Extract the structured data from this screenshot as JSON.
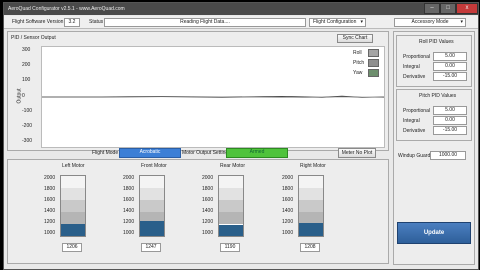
{
  "window": {
    "title": "AeroQuad Configurator v2.5.1 - www.AeroQuad.com",
    "buttons": [
      "–",
      "□",
      "x"
    ]
  },
  "toolbar": {
    "fw_label": "Flight Software Version",
    "fw_value": "3.2",
    "status_label": "Status",
    "status_value": "Reading Flight Data....",
    "view_select": "Flight Configuration",
    "right_select": "Accessory Mode"
  },
  "pid_graph": {
    "title": "PID / Sensor Output",
    "sync_button": "Sync Chart",
    "ylabel": "Output",
    "yticks": [
      "300",
      "200",
      "100",
      "0",
      "-100",
      "-200",
      "-300"
    ],
    "legend": [
      "Roll",
      "Pitch",
      "Yaw"
    ]
  },
  "modes": {
    "flight_mode_label": "Flight Mode",
    "flight_mode_value": "Acrobatic",
    "motor_output_label": "Motor Output Setting",
    "motor_output_value": "Armed",
    "meter_button": "Meter No Plot"
  },
  "motors": [
    {
      "label": "Left Motor",
      "value": "1206",
      "level": 0.2
    },
    {
      "label": "Front Motor",
      "value": "1247",
      "level": 0.25
    },
    {
      "label": "Rear Motor",
      "value": "1190",
      "level": 0.19
    },
    {
      "label": "Right Motor",
      "value": "1208",
      "level": 0.21
    }
  ],
  "motor_ticks": [
    "2000",
    "1800",
    "1600",
    "1400",
    "1200",
    "1000"
  ],
  "roll_pid": {
    "title": "Roll PID Values",
    "fields": [
      {
        "label": "Proportional",
        "value": "5.00"
      },
      {
        "label": "Integral",
        "value": "0.00"
      },
      {
        "label": "Derivative",
        "value": "-15.00"
      }
    ]
  },
  "pitch_pid": {
    "title": "Pitch PID Values",
    "fields": [
      {
        "label": "Proportional",
        "value": "5.00"
      },
      {
        "label": "Integral",
        "value": "0.00"
      },
      {
        "label": "Derivative",
        "value": "-15.00"
      }
    ]
  },
  "windup": {
    "label": "Windup Guard",
    "value": "1000.00"
  },
  "update_button": "Update",
  "colors": {
    "accent_blue": "#3c7fd6",
    "armed_green": "#4fc33c",
    "motor_fill": "#2a5f8a",
    "update_blue": "#2e5f9a"
  }
}
